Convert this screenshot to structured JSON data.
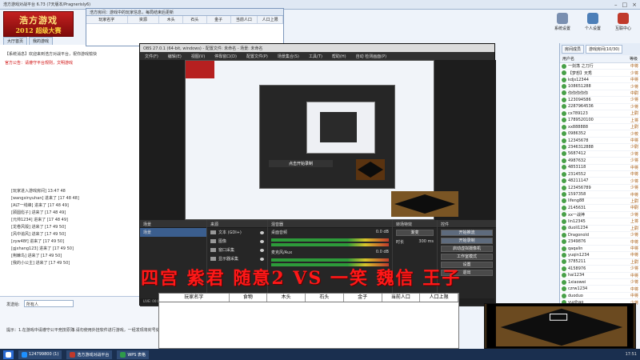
{
  "lobby": {
    "title": "浩方游戏对战平台 6.73 (7天版本/Pragnerisly6)",
    "logo_main": "浩方游戏",
    "logo_sub": "2012 超级大赛",
    "tabs": [
      "大厅首页",
      "我的游戏"
    ],
    "toolbar": [
      "系统设置",
      "个人设置",
      "互联中心"
    ],
    "left_lines": [
      {
        "text": "【系统消息】欢迎来到浩方对战平台，祝你游戏愉快",
        "red": false
      },
      {
        "text": "官方公告：请遵守平台规则，文明游戏",
        "red": true
      }
    ],
    "chat": [
      "[玩家进入游戏房间] 13:47 48",
      "[wangxinyuhan] 进来了 [17 48 48]",
      "[ALT一线峰] 进来了 [17 48 49]",
      "[顾圆彪子] 进来了 [17 48 49]",
      "[元帅1234] 进来了 [17 48 49]",
      "[龙卷风毁] 进来了 [17 49 50]",
      "[风中追风] 进来了 [17 49 50]",
      "[zyw48f] 进来了 [17 49 50]",
      "[gjxhang123] 进来了 [17 49 50]",
      "[荆棘鸟] 进来了 [17 49 50]",
      "[我的小公主] 进来了 [17 49 50]"
    ],
    "bottom": {
      "send_target_label": "发送给:",
      "send_target_value": "所有人",
      "hint1": "提示：1.在游戏中请遵守公平竞技原则",
      "hint2": "3.请勿使用外挂软件进行游戏，一经发现将封号处理"
    }
  },
  "table_window": {
    "title": "浩方房间：游戏中的玩家信息，每局结束后更新",
    "headers": [
      "玩家名字",
      "资源",
      "木头",
      "石头",
      "金子",
      "当前人口",
      "人口上限"
    ]
  },
  "players": {
    "tabs": [
      "房间成员",
      "游戏房间(10/30)"
    ],
    "head_name": "用户名",
    "head_rank": "等级",
    "list": [
      {
        "name": "一剑荡 之刀行",
        "rank": "中将"
      },
      {
        "name": "【梦想】天秀",
        "rank": "少将"
      },
      {
        "name": "kdjs12344",
        "rank": "中将"
      },
      {
        "name": "108651288",
        "rank": "少将"
      },
      {
        "name": "你你你你你",
        "rank": "中尉"
      },
      {
        "name": "123094586",
        "rank": "少将"
      },
      {
        "name": "2287964536",
        "rank": "少将"
      },
      {
        "name": "cx789123",
        "rank": "上尉"
      },
      {
        "name": "1789520100",
        "rank": "上将"
      },
      {
        "name": "xx888888",
        "rank": "上尉"
      },
      {
        "name": "0986352",
        "rank": "少校"
      },
      {
        "name": "12345678",
        "rank": "中将"
      },
      {
        "name": "2346312888",
        "rank": "少尉"
      },
      {
        "name": "5687412",
        "rank": "少将"
      },
      {
        "name": "4987632",
        "rank": "少将"
      },
      {
        "name": "4853118",
        "rank": "中将"
      },
      {
        "name": "2314552",
        "rank": "中将"
      },
      {
        "name": "48211147",
        "rank": "少将"
      },
      {
        "name": "123456789",
        "rank": "少将"
      },
      {
        "name": "1597358",
        "rank": "中将"
      },
      {
        "name": "lifeng88",
        "rank": "上尉"
      },
      {
        "name": "2145631",
        "rank": "中尉"
      },
      {
        "name": "xx一战神",
        "rank": "少将"
      },
      {
        "name": "lin12345",
        "rank": "上将"
      },
      {
        "name": "duoli1234",
        "rank": "上尉"
      },
      {
        "name": "Dragonold",
        "rank": "少将"
      },
      {
        "name": "2349876",
        "rank": "中将"
      },
      {
        "name": "qaqalin",
        "rank": "中将"
      },
      {
        "name": "yuqin1234",
        "rank": "中将"
      },
      {
        "name": "3785211",
        "rank": "上尉"
      },
      {
        "name": "4158976",
        "rank": "少将"
      },
      {
        "name": "hai1234",
        "rank": "中将"
      },
      {
        "name": "1xiaowei",
        "rank": "少将"
      },
      {
        "name": "czrw1234",
        "rank": "中将"
      },
      {
        "name": "duoduo",
        "rank": "中将"
      },
      {
        "name": "yuzihao",
        "rank": "少将"
      }
    ]
  },
  "obs": {
    "title": "OBS 27.0.1 (64-bit, windows) - 配置文件: 未命名 - 场景: 未命名",
    "menu": [
      "文件(F)",
      "编辑(E)",
      "视图(V)",
      "停靠窗口(D)",
      "配置文件(P)",
      "场景集合(S)",
      "工具(T)",
      "帮助(H)",
      "自动 检测画面(P)"
    ],
    "preview_caption": "点击开始录制",
    "docks": {
      "scenes": "场景",
      "sources": "来源",
      "mixer": "混音器",
      "transitions": "转场特效",
      "controls": "控件"
    },
    "scene_items": [
      "场景"
    ],
    "source_items": [
      "文本 (GDI+)",
      "图像",
      "窗口采集",
      "显示器采集"
    ],
    "mixer": [
      {
        "name": "桌面音频",
        "db": "0.0 dB"
      },
      {
        "name": "麦克风/Aux",
        "db": "0.0 dB"
      }
    ],
    "transition_value": "渐变",
    "transition_duration": "300 ms",
    "transition_duration_label": "时长",
    "controls": [
      "开始推流",
      "开始录制",
      "启动虚拟摄像机",
      "工作室模式",
      "设置",
      "退出"
    ],
    "status": "LIVE: 00:00:00  REC: 00:00:00  CPU: 4.1%, 30.00 fps"
  },
  "banner": "四宫 紫君 随意2 VS 一笑 魏信 王子",
  "stats": {
    "headers": [
      "玩家名字",
      "食物",
      "木头",
      "石头",
      "金子",
      "当前人口",
      "人口上限"
    ]
  },
  "taskbar": {
    "items": [
      "124799800 (1)",
      "浩方游戏对战平台",
      "WPS 表格"
    ],
    "clock": "17:51"
  },
  "colors": {
    "banner": "#ff1818",
    "obs_bg": "#2b2b2b",
    "taskbar": "#1a2f4f"
  }
}
